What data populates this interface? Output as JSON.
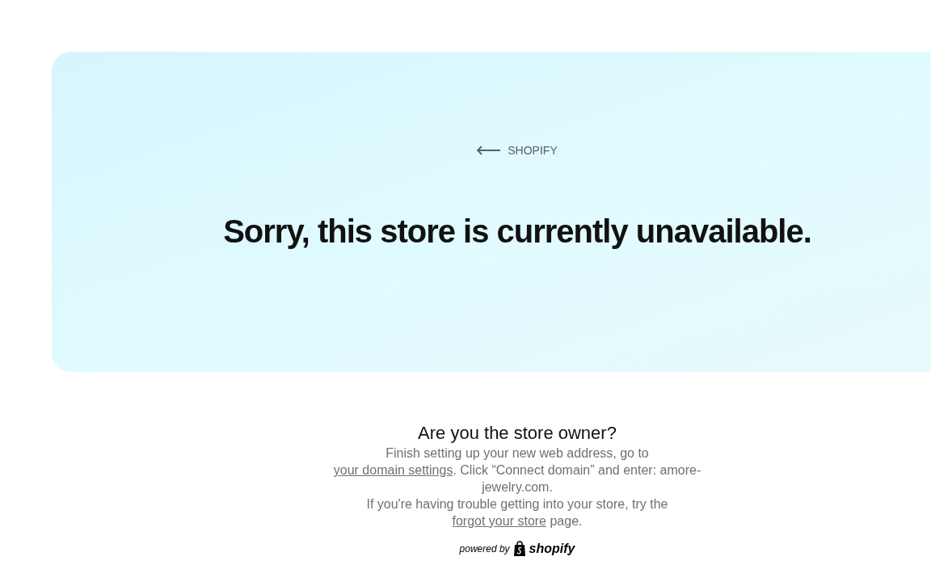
{
  "hero": {
    "back_link": "SHOPIFY",
    "heading": "Sorry, this store is currently unavailable."
  },
  "owner": {
    "heading": "Are you the store owner?",
    "paragraphs": [
      {
        "before": "Finish setting up your new web address, go to ",
        "link": "your domain settings",
        "after": ". Click “Connect domain” and enter: amore-jewelry.com."
      },
      {
        "before": "If you're having trouble getting into your store, try the ",
        "link": "forgot your store",
        "after": " page."
      }
    ]
  },
  "footer": {
    "powered_by": "powered by",
    "brand": "shopify"
  }
}
